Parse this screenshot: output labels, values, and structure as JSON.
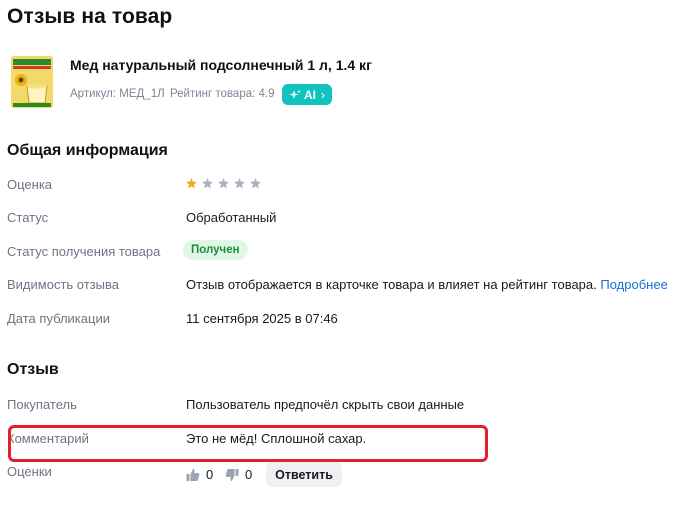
{
  "page": {
    "title": "Отзыв на товар"
  },
  "product": {
    "name": "Мед натуральный подсолнечный 1 л, 1.4 кг",
    "sku": "Артикул: МЕД_1Л",
    "rating": "Рейтинг товара: 4.9",
    "ai_label": "AI"
  },
  "general": {
    "title": "Общая информация",
    "rating_label": "Оценка",
    "rating_value": 1,
    "rating_max": 5,
    "status_label": "Статус",
    "status_value": "Обработанный",
    "receipt_label": "Статус получения товара",
    "receipt_value": "Получен",
    "visibility_label": "Видимость отзыва",
    "visibility_value": "Отзыв отображается в карточке товара и влияет на рейтинг товара.",
    "visibility_link": "Подробнее",
    "date_label": "Дата публикации",
    "date_value": "11 сентября 2025 в 07:46"
  },
  "review": {
    "title": "Отзыв",
    "buyer_label": "Покупатель",
    "buyer_value": "Пользователь предпочёл скрыть свои данные",
    "comment_label": "Комментарий",
    "comment_value": "Это не мёд! Сплошной сахар.",
    "votes_label": "Оценки",
    "likes": "0",
    "dislikes": "0",
    "reply_label": "Ответить"
  },
  "colors": {
    "accent_teal": "#11c2bf",
    "star_filled": "#f5a623",
    "star_empty": "#a9b4c2",
    "status_green": "#1f8a3b",
    "link_blue": "#1d6ed8",
    "highlight_red": "#e0202c"
  }
}
